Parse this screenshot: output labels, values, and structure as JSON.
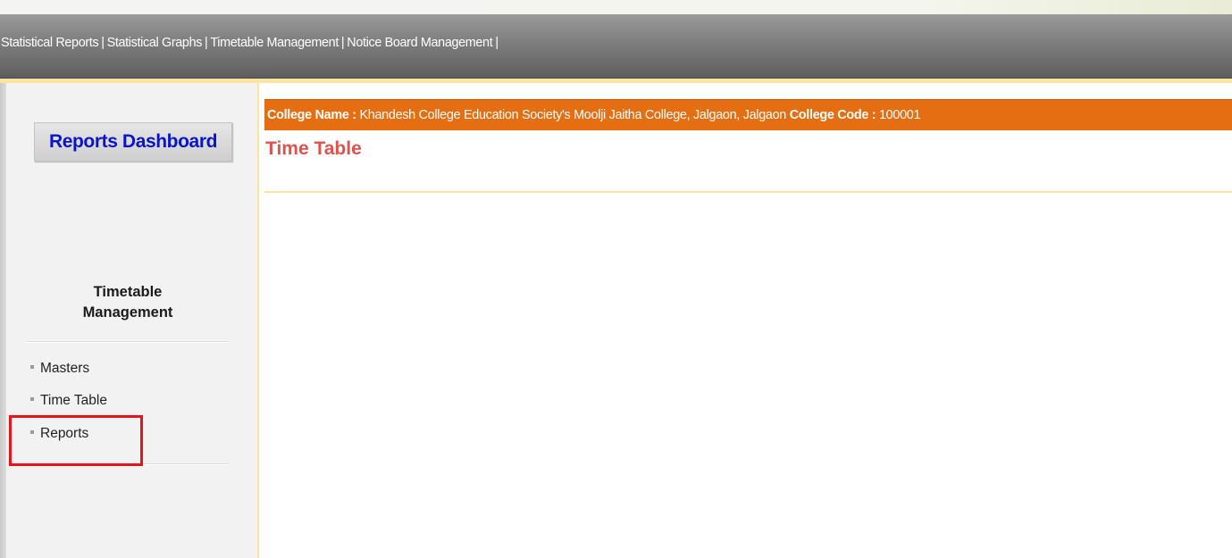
{
  "nav": {
    "items": [
      {
        "label": "Statistical Reports"
      },
      {
        "label": "Statistical Graphs"
      },
      {
        "label": "Timetable Management"
      },
      {
        "label": "Notice Board Management"
      }
    ],
    "separator": "|"
  },
  "sidebar": {
    "dashboard_button": "Reports Dashboard",
    "section_title_line1": "Timetable",
    "section_title_line2": "Management",
    "items": [
      {
        "label": "Masters"
      },
      {
        "label": "Time Table"
      },
      {
        "label": "Reports",
        "highlighted": true
      }
    ]
  },
  "main": {
    "college_name_label": "College Name :",
    "college_name": "Khandesh College Education Society's Moolji Jaitha College, Jalgaon, Jalgaon",
    "college_code_label": "College Code :",
    "college_code": "100001",
    "page_title": "Time Table"
  },
  "colors": {
    "banner": "#e56e12",
    "title": "#e0534c",
    "dashboard_text": "#0a14c9",
    "highlight_box": "#e8141c",
    "accent_rule": "#fbe4a1"
  }
}
